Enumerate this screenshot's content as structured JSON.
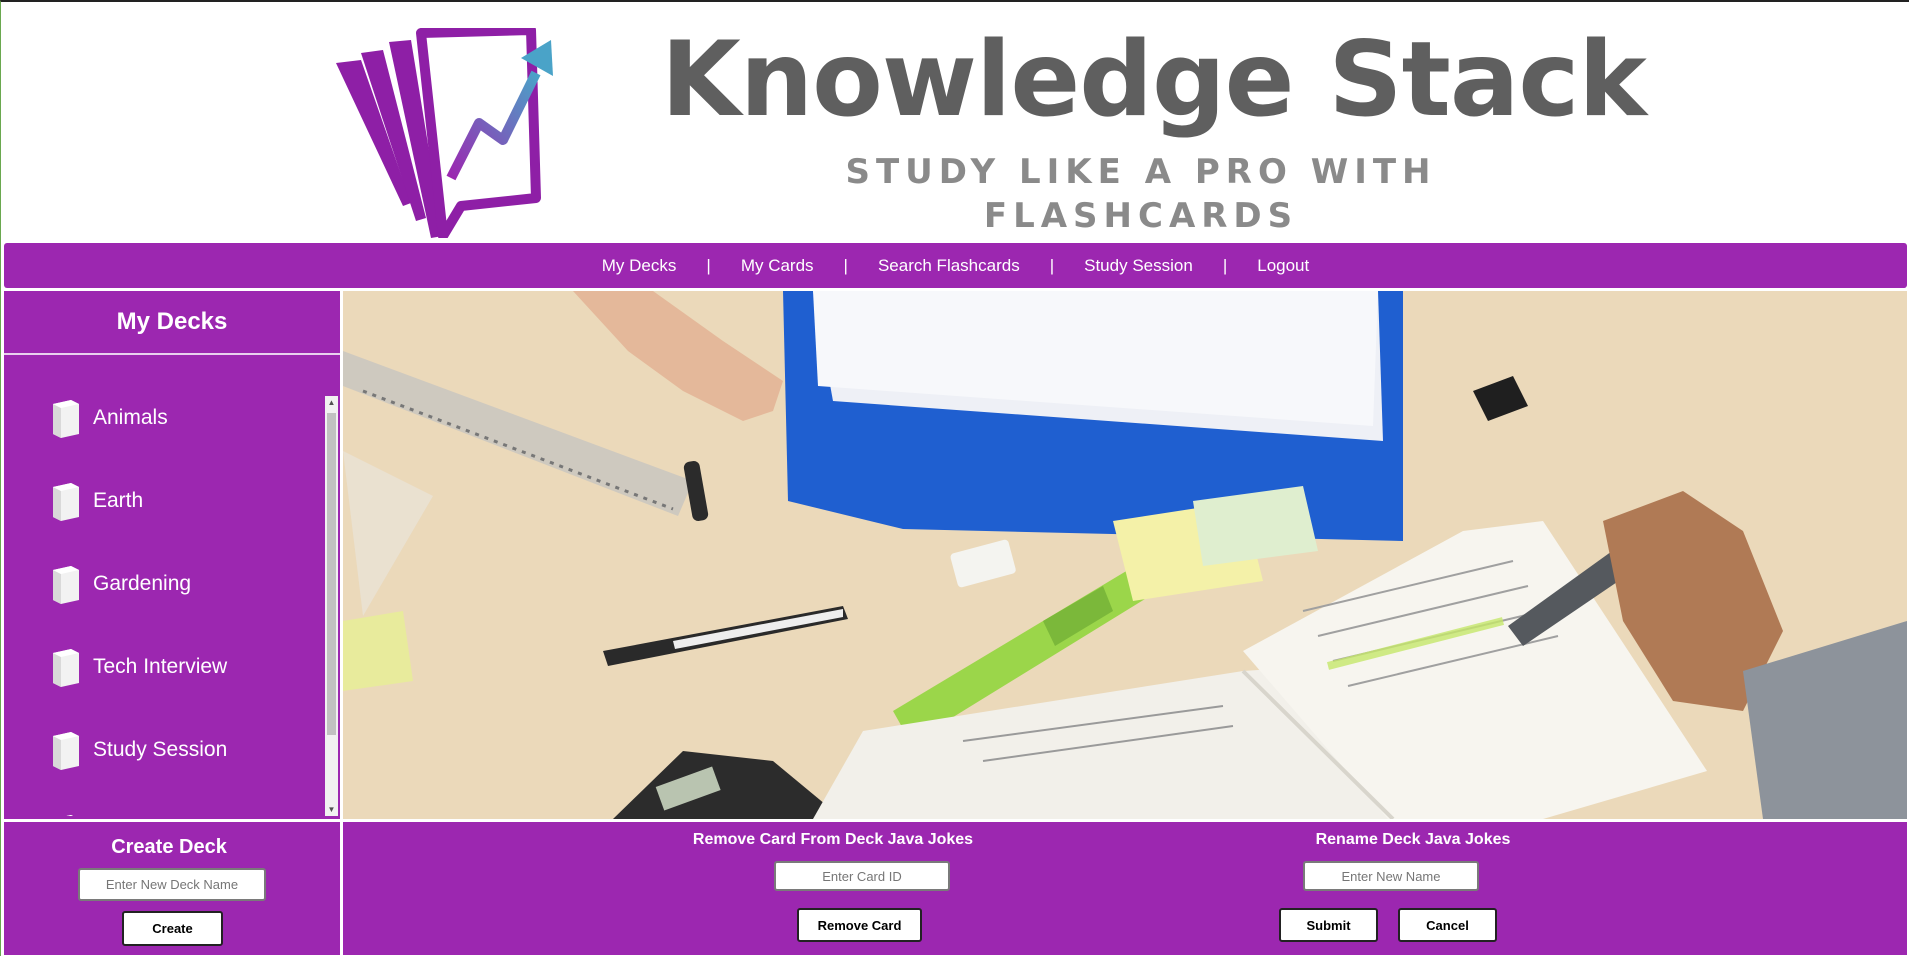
{
  "brand": {
    "title": "Knowledge Stack",
    "tagline": "STUDY LIKE A PRO WITH FLASHCARDS",
    "logo_icon": "flashcards-growth-logo"
  },
  "nav": {
    "items": [
      {
        "label": "My Decks"
      },
      {
        "label": "My Cards"
      },
      {
        "label": "Search Flashcards"
      },
      {
        "label": "Study Session"
      },
      {
        "label": "Logout"
      }
    ],
    "separator": "|"
  },
  "sidebar": {
    "title": "My Decks",
    "deck_icon": "deck-icon",
    "decks": [
      {
        "label": "Animals"
      },
      {
        "label": "Earth"
      },
      {
        "label": "Gardening"
      },
      {
        "label": "Tech Interview"
      },
      {
        "label": "Study Session"
      }
    ]
  },
  "hero": {
    "image_icon": "study-desk-photo"
  },
  "create_deck": {
    "title": "Create Deck",
    "input_placeholder": "Enter New Deck Name",
    "input_value": "",
    "button_label": "Create"
  },
  "remove_card": {
    "title": "Remove Card From Deck Java Jokes",
    "input_placeholder": "Enter Card ID",
    "input_value": "",
    "button_label": "Remove Card"
  },
  "rename_deck": {
    "title": "Rename Deck Java Jokes",
    "input_placeholder": "Enter New Name",
    "input_value": "",
    "submit_label": "Submit",
    "cancel_label": "Cancel"
  },
  "colors": {
    "accent": "#9c27b0",
    "title_text": "#5f5f5f",
    "tagline_text": "#8a8a8a",
    "white": "#ffffff"
  }
}
